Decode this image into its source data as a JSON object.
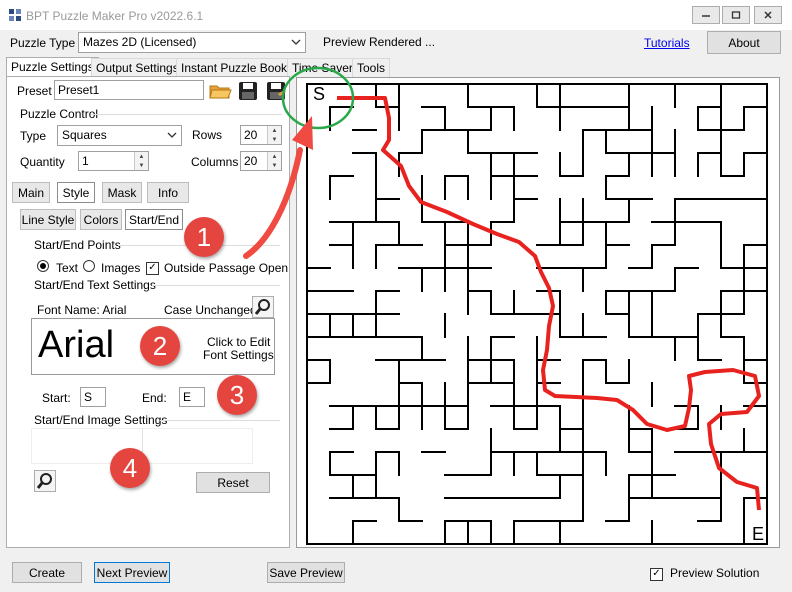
{
  "window": {
    "title": "BPT Puzzle Maker Pro v2022.6.1",
    "minimize_icon": "minimize-icon",
    "maximize_icon": "maximize-icon",
    "close_icon": "close-icon"
  },
  "menubar": {
    "puzzle_type_label": "Puzzle Type",
    "puzzle_type_value": "Mazes 2D (Licensed)",
    "status": "Preview Rendered ...",
    "tutorials_link": "Tutorials",
    "about_button": "About"
  },
  "tabs": [
    {
      "label": "Puzzle Settings",
      "active": true
    },
    {
      "label": "Output Settings",
      "active": false
    },
    {
      "label": "Instant Puzzle Books",
      "active": false
    },
    {
      "label": "Time Saver",
      "active": false
    },
    {
      "label": "Tools",
      "active": false
    }
  ],
  "preset": {
    "label": "Preset",
    "value": "Preset1"
  },
  "puzzle_control": {
    "title": "Puzzle Control",
    "type_label": "Type",
    "type_value": "Squares",
    "rows_label": "Rows",
    "rows_value": "20",
    "quantity_label": "Quantity",
    "quantity_value": "1",
    "columns_label": "Columns",
    "columns_value": "20"
  },
  "subtabs": [
    "Main",
    "Style",
    "Mask",
    "Info"
  ],
  "style_tabs": [
    "Line Style",
    "Colors",
    "Start/End"
  ],
  "start_end": {
    "points_title": "Start/End Points",
    "text_option": "Text",
    "images_option": "Images",
    "outside_passage": "Outside Passage Open",
    "text_settings_title": "Start/End Text Settings",
    "font_name_label": "Font Name: Arial",
    "case_label": "Case Unchanged",
    "font_preview": "Arial",
    "click_to_edit_1": "Click to Edit",
    "click_to_edit_2": "Font Settings",
    "start_label": "Start:",
    "start_value": "S",
    "end_label": "End:",
    "end_value": "E",
    "image_settings_title": "Start/End Image Settings",
    "reset_button": "Reset"
  },
  "badges": [
    "1",
    "2",
    "3",
    "4"
  ],
  "maze": {
    "start_mark": "S",
    "end_mark": "E",
    "solution_color": "#e8231f",
    "highlight_color": "#2ba84a",
    "arrow_color": "#ef4b42"
  },
  "bottom": {
    "create_button": "Create",
    "next_preview_button": "Next Preview",
    "save_preview_button": "Save Preview",
    "preview_solution_label": "Preview Solution"
  }
}
